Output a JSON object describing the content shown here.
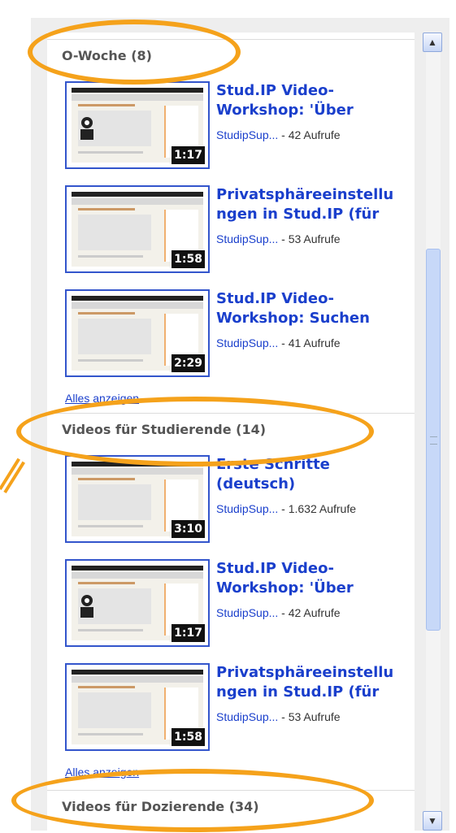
{
  "sections": [
    {
      "title": "O-Woche (8)",
      "items": [
        {
          "title": "Stud.IP Video-\nWorkshop: 'Über",
          "author": "StudipSup...",
          "views": " - 42 Aufrufe",
          "duration": "1:17",
          "person": true
        },
        {
          "title": "Privatsphäreeinstellu\nngen in Stud.IP (für",
          "author": "StudipSup...",
          "views": " - 53 Aufrufe",
          "duration": "1:58",
          "person": false
        },
        {
          "title": "Stud.IP Video-\nWorkshop: Suchen",
          "author": "StudipSup...",
          "views": " - 41 Aufrufe",
          "duration": "2:29",
          "person": false
        }
      ],
      "show_all": "Alles anzeigen"
    },
    {
      "title": "Videos für Studierende (14)",
      "items": [
        {
          "title": "Erste Schritte\n(deutsch)",
          "author": "StudipSup...",
          "views": " - 1.632 Aufrufe",
          "duration": "3:10",
          "person": false
        },
        {
          "title": "Stud.IP Video-\nWorkshop: 'Über",
          "author": "StudipSup...",
          "views": " - 42 Aufrufe",
          "duration": "1:17",
          "person": true
        },
        {
          "title": "Privatsphäreeinstellu\nngen in Stud.IP (für",
          "author": "StudipSup...",
          "views": " - 53 Aufrufe",
          "duration": "1:58",
          "person": false
        }
      ],
      "show_all": "Alles anzeigen"
    },
    {
      "title": "Videos für Dozierende (34)",
      "items": []
    }
  ],
  "scrollbar": {
    "up_icon": "chevron-up-icon",
    "down_icon": "chevron-down-icon"
  },
  "colors": {
    "accent_link": "#1a3fcc",
    "highlight": "#f5a21b"
  }
}
